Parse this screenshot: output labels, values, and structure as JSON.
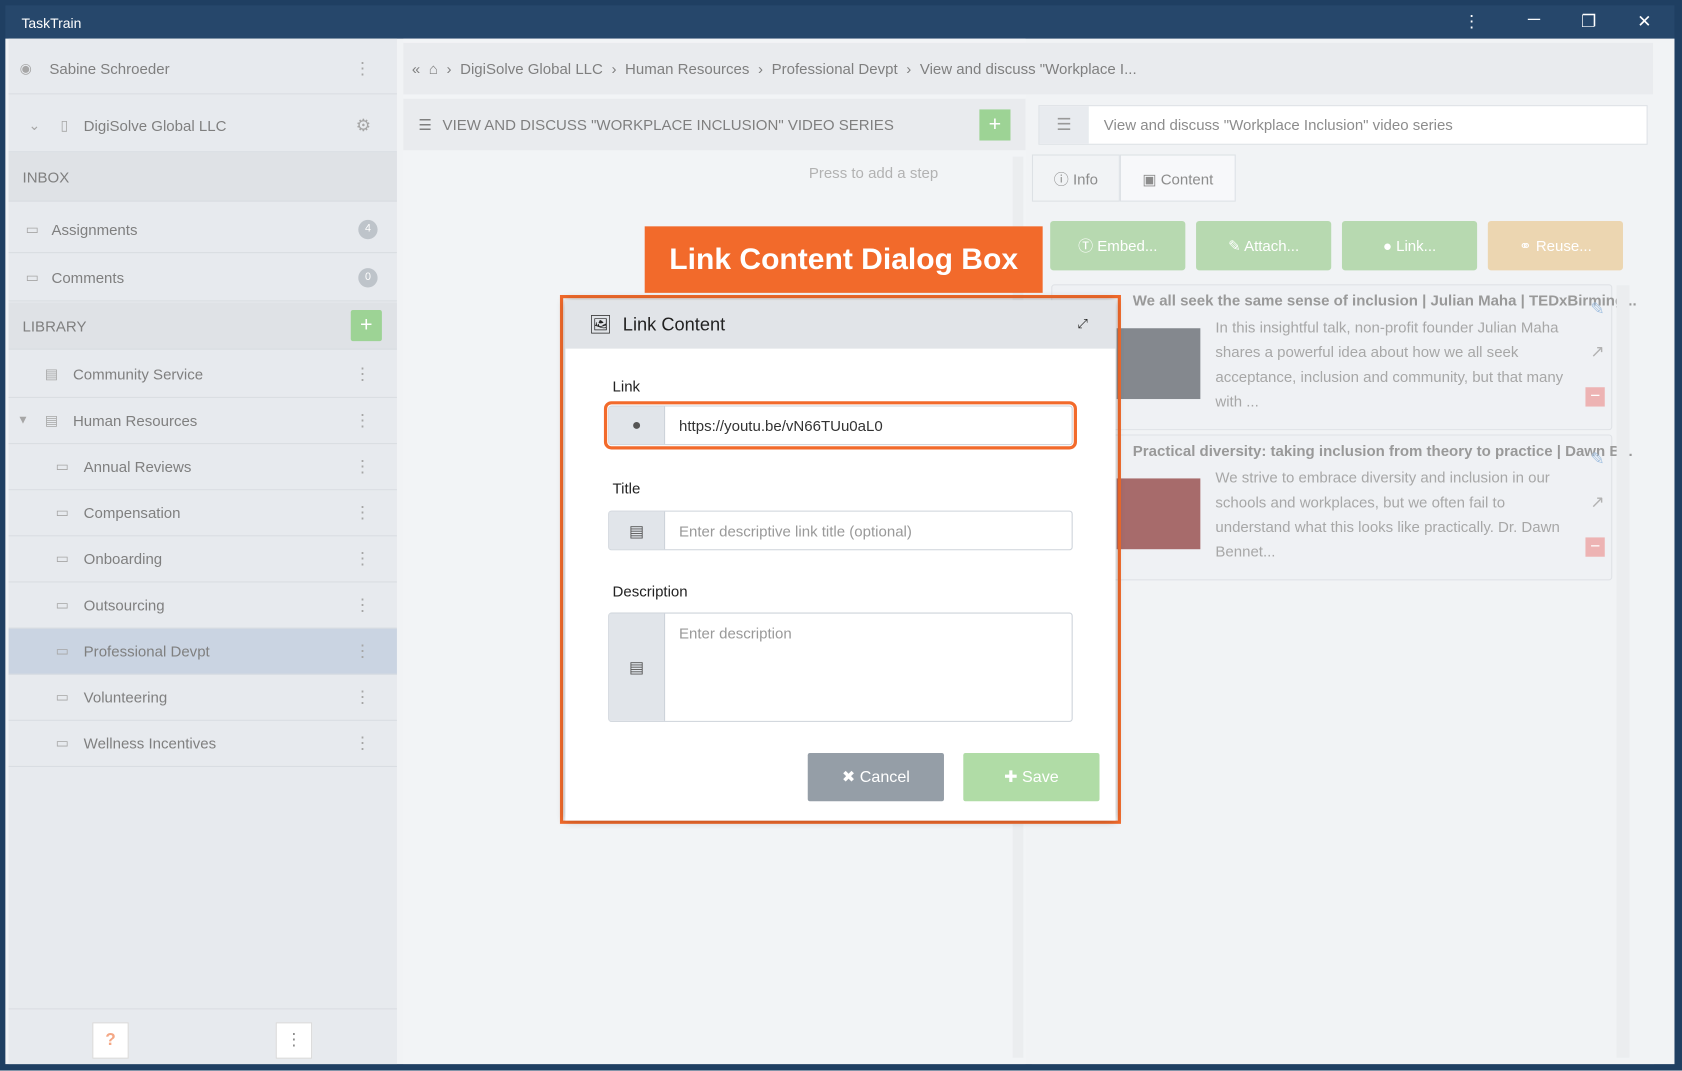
{
  "window": {
    "title": "TaskTrain",
    "menu_icon": "kebab-icon",
    "minimize": "─",
    "restore": "❐",
    "close": "✕"
  },
  "sidebar": {
    "user": "Sabine Schroeder",
    "org": "DigiSolve Global LLC",
    "inbox_header": "INBOX",
    "inbox": [
      {
        "label": "Assignments",
        "count": "4"
      },
      {
        "label": "Comments",
        "count": "0"
      }
    ],
    "library_header": "LIBRARY",
    "library": [
      {
        "label": "Community Service",
        "level": 1
      },
      {
        "label": "Human Resources",
        "level": 1
      },
      {
        "label": "Annual Reviews",
        "level": 2
      },
      {
        "label": "Compensation",
        "level": 2
      },
      {
        "label": "Onboarding",
        "level": 2
      },
      {
        "label": "Outsourcing",
        "level": 2
      },
      {
        "label": "Professional Devpt",
        "level": 2,
        "selected": true
      },
      {
        "label": "Volunteering",
        "level": 2
      },
      {
        "label": "Wellness Incentives",
        "level": 2
      }
    ],
    "help": "?"
  },
  "breadcrumb": [
    "DigiSolve Global LLC",
    "Human Resources",
    "Professional Devpt",
    "View and discuss \"Workplace I..."
  ],
  "middle": {
    "title": "VIEW AND DISCUSS \"WORKPLACE INCLUSION\" VIDEO SERIES",
    "hint": "Press to add a step"
  },
  "right": {
    "title_value": "View and discuss \"Workplace Inclusion\" video series",
    "tabs": [
      "Info",
      "Content"
    ],
    "buttons": [
      "Embed...",
      "Attach...",
      "Link...",
      "Reuse..."
    ],
    "cards": [
      {
        "title": "We all seek the same sense of inclusion | Julian Maha | TEDxBirming...",
        "desc": "In this insightful talk, non-profit founder Julian Maha shares a powerful idea about how we all seek acceptance, inclusion and community, but that many with ..."
      },
      {
        "title": "Practical diversity: taking inclusion from theory to practice | Dawn B...",
        "desc": "We strive to embrace diversity and inclusion in our schools and workplaces, but we often fail to understand what this looks like practically. Dr. Dawn Bennet..."
      }
    ]
  },
  "callout": "Link Content Dialog Box",
  "dialog": {
    "title": "Link Content",
    "link_label": "Link",
    "link_value": "https://youtu.be/vN66TUu0aL0",
    "title_label": "Title",
    "title_placeholder": "Enter descriptive link title (optional)",
    "desc_label": "Description",
    "desc_placeholder": "Enter description",
    "cancel": "Cancel",
    "save": "Save"
  },
  "colors": {
    "accent": "#f26a2b",
    "titlebar": "#26476b",
    "green": "#9fcd96",
    "reuse": "#e6c897"
  }
}
